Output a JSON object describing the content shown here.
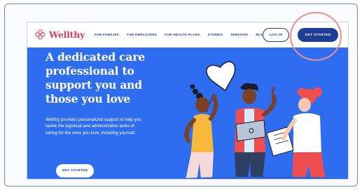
{
  "brand": {
    "name": "Wellthy",
    "logo_icon": "wellthy-flower-icon",
    "color": "#d8435b"
  },
  "nav": {
    "links": [
      "FOR FAMILIES",
      "FOR EMPLOYERS",
      "FOR HEALTH PLANS",
      "STORIES",
      "SERVICES",
      "BLOG"
    ],
    "login_label": "LOG IN",
    "get_started_label": "GET STARTED"
  },
  "hero": {
    "title": "A dedicated care professional to support you and those you love",
    "body": "Wellthy provides personalized support to help you tackle the logistical and administrative tasks of caring for the ones you love, including yourself.",
    "cta_label": "GET STARTED"
  },
  "colors": {
    "hero_bg": "#2f6df0",
    "nav_text": "#233a86",
    "button_dark": "#1f3e96",
    "annotation": "#ef8f86"
  },
  "chat": {
    "icon": "chat-bubble-icon"
  }
}
